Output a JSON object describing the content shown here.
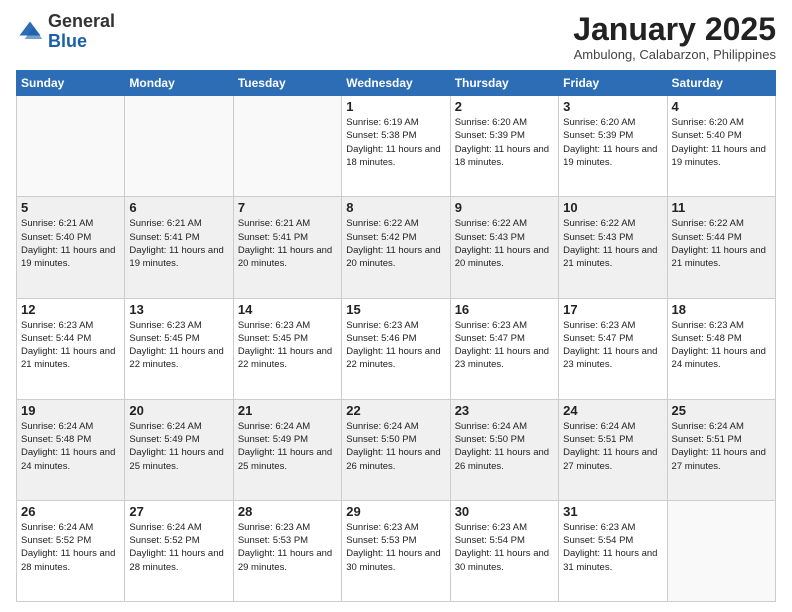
{
  "header": {
    "logo_general": "General",
    "logo_blue": "Blue",
    "month_title": "January 2025",
    "location": "Ambulong, Calabarzon, Philippines"
  },
  "weekdays": [
    "Sunday",
    "Monday",
    "Tuesday",
    "Wednesday",
    "Thursday",
    "Friday",
    "Saturday"
  ],
  "weeks": [
    [
      {
        "day": "",
        "sunrise": "",
        "sunset": "",
        "daylight": ""
      },
      {
        "day": "",
        "sunrise": "",
        "sunset": "",
        "daylight": ""
      },
      {
        "day": "",
        "sunrise": "",
        "sunset": "",
        "daylight": ""
      },
      {
        "day": "1",
        "sunrise": "Sunrise: 6:19 AM",
        "sunset": "Sunset: 5:38 PM",
        "daylight": "Daylight: 11 hours and 18 minutes."
      },
      {
        "day": "2",
        "sunrise": "Sunrise: 6:20 AM",
        "sunset": "Sunset: 5:39 PM",
        "daylight": "Daylight: 11 hours and 18 minutes."
      },
      {
        "day": "3",
        "sunrise": "Sunrise: 6:20 AM",
        "sunset": "Sunset: 5:39 PM",
        "daylight": "Daylight: 11 hours and 19 minutes."
      },
      {
        "day": "4",
        "sunrise": "Sunrise: 6:20 AM",
        "sunset": "Sunset: 5:40 PM",
        "daylight": "Daylight: 11 hours and 19 minutes."
      }
    ],
    [
      {
        "day": "5",
        "sunrise": "Sunrise: 6:21 AM",
        "sunset": "Sunset: 5:40 PM",
        "daylight": "Daylight: 11 hours and 19 minutes."
      },
      {
        "day": "6",
        "sunrise": "Sunrise: 6:21 AM",
        "sunset": "Sunset: 5:41 PM",
        "daylight": "Daylight: 11 hours and 19 minutes."
      },
      {
        "day": "7",
        "sunrise": "Sunrise: 6:21 AM",
        "sunset": "Sunset: 5:41 PM",
        "daylight": "Daylight: 11 hours and 20 minutes."
      },
      {
        "day": "8",
        "sunrise": "Sunrise: 6:22 AM",
        "sunset": "Sunset: 5:42 PM",
        "daylight": "Daylight: 11 hours and 20 minutes."
      },
      {
        "day": "9",
        "sunrise": "Sunrise: 6:22 AM",
        "sunset": "Sunset: 5:43 PM",
        "daylight": "Daylight: 11 hours and 20 minutes."
      },
      {
        "day": "10",
        "sunrise": "Sunrise: 6:22 AM",
        "sunset": "Sunset: 5:43 PM",
        "daylight": "Daylight: 11 hours and 21 minutes."
      },
      {
        "day": "11",
        "sunrise": "Sunrise: 6:22 AM",
        "sunset": "Sunset: 5:44 PM",
        "daylight": "Daylight: 11 hours and 21 minutes."
      }
    ],
    [
      {
        "day": "12",
        "sunrise": "Sunrise: 6:23 AM",
        "sunset": "Sunset: 5:44 PM",
        "daylight": "Daylight: 11 hours and 21 minutes."
      },
      {
        "day": "13",
        "sunrise": "Sunrise: 6:23 AM",
        "sunset": "Sunset: 5:45 PM",
        "daylight": "Daylight: 11 hours and 22 minutes."
      },
      {
        "day": "14",
        "sunrise": "Sunrise: 6:23 AM",
        "sunset": "Sunset: 5:45 PM",
        "daylight": "Daylight: 11 hours and 22 minutes."
      },
      {
        "day": "15",
        "sunrise": "Sunrise: 6:23 AM",
        "sunset": "Sunset: 5:46 PM",
        "daylight": "Daylight: 11 hours and 22 minutes."
      },
      {
        "day": "16",
        "sunrise": "Sunrise: 6:23 AM",
        "sunset": "Sunset: 5:47 PM",
        "daylight": "Daylight: 11 hours and 23 minutes."
      },
      {
        "day": "17",
        "sunrise": "Sunrise: 6:23 AM",
        "sunset": "Sunset: 5:47 PM",
        "daylight": "Daylight: 11 hours and 23 minutes."
      },
      {
        "day": "18",
        "sunrise": "Sunrise: 6:23 AM",
        "sunset": "Sunset: 5:48 PM",
        "daylight": "Daylight: 11 hours and 24 minutes."
      }
    ],
    [
      {
        "day": "19",
        "sunrise": "Sunrise: 6:24 AM",
        "sunset": "Sunset: 5:48 PM",
        "daylight": "Daylight: 11 hours and 24 minutes."
      },
      {
        "day": "20",
        "sunrise": "Sunrise: 6:24 AM",
        "sunset": "Sunset: 5:49 PM",
        "daylight": "Daylight: 11 hours and 25 minutes."
      },
      {
        "day": "21",
        "sunrise": "Sunrise: 6:24 AM",
        "sunset": "Sunset: 5:49 PM",
        "daylight": "Daylight: 11 hours and 25 minutes."
      },
      {
        "day": "22",
        "sunrise": "Sunrise: 6:24 AM",
        "sunset": "Sunset: 5:50 PM",
        "daylight": "Daylight: 11 hours and 26 minutes."
      },
      {
        "day": "23",
        "sunrise": "Sunrise: 6:24 AM",
        "sunset": "Sunset: 5:50 PM",
        "daylight": "Daylight: 11 hours and 26 minutes."
      },
      {
        "day": "24",
        "sunrise": "Sunrise: 6:24 AM",
        "sunset": "Sunset: 5:51 PM",
        "daylight": "Daylight: 11 hours and 27 minutes."
      },
      {
        "day": "25",
        "sunrise": "Sunrise: 6:24 AM",
        "sunset": "Sunset: 5:51 PM",
        "daylight": "Daylight: 11 hours and 27 minutes."
      }
    ],
    [
      {
        "day": "26",
        "sunrise": "Sunrise: 6:24 AM",
        "sunset": "Sunset: 5:52 PM",
        "daylight": "Daylight: 11 hours and 28 minutes."
      },
      {
        "day": "27",
        "sunrise": "Sunrise: 6:24 AM",
        "sunset": "Sunset: 5:52 PM",
        "daylight": "Daylight: 11 hours and 28 minutes."
      },
      {
        "day": "28",
        "sunrise": "Sunrise: 6:23 AM",
        "sunset": "Sunset: 5:53 PM",
        "daylight": "Daylight: 11 hours and 29 minutes."
      },
      {
        "day": "29",
        "sunrise": "Sunrise: 6:23 AM",
        "sunset": "Sunset: 5:53 PM",
        "daylight": "Daylight: 11 hours and 30 minutes."
      },
      {
        "day": "30",
        "sunrise": "Sunrise: 6:23 AM",
        "sunset": "Sunset: 5:54 PM",
        "daylight": "Daylight: 11 hours and 30 minutes."
      },
      {
        "day": "31",
        "sunrise": "Sunrise: 6:23 AM",
        "sunset": "Sunset: 5:54 PM",
        "daylight": "Daylight: 11 hours and 31 minutes."
      },
      {
        "day": "",
        "sunrise": "",
        "sunset": "",
        "daylight": ""
      }
    ]
  ]
}
